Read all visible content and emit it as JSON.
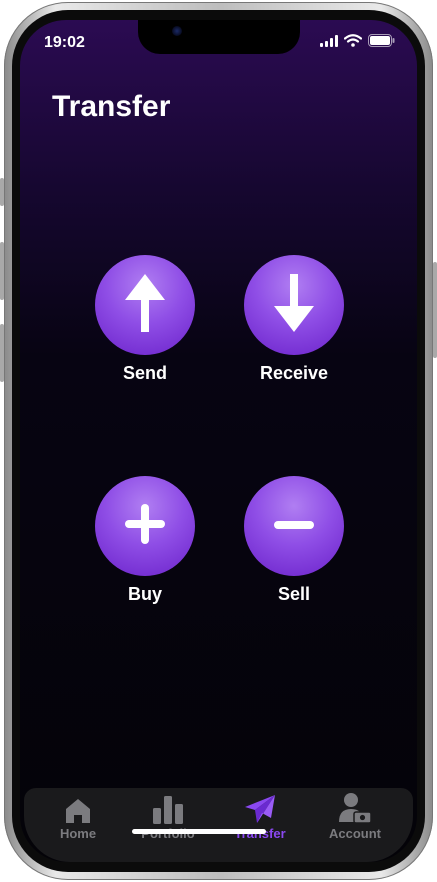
{
  "status_bar": {
    "time": "19:02"
  },
  "page": {
    "title": "Transfer"
  },
  "actions": [
    {
      "label": "Send",
      "icon": "arrow-up-icon"
    },
    {
      "label": "Receive",
      "icon": "arrow-down-icon"
    },
    {
      "label": "Buy",
      "icon": "plus-icon"
    },
    {
      "label": "Sell",
      "icon": "minus-icon"
    }
  ],
  "tabbar": {
    "items": [
      {
        "label": "Home",
        "icon": "house-icon",
        "active": false
      },
      {
        "label": "Portfolio",
        "icon": "bar-chart-icon",
        "active": false
      },
      {
        "label": "Transfer",
        "icon": "paper-plane-icon",
        "active": true
      },
      {
        "label": "Account",
        "icon": "user-cash-icon",
        "active": false
      }
    ]
  },
  "colors": {
    "accent": "#8a48f0",
    "button_gradient_light": "#b07ef2",
    "button_gradient_dark": "#6a21c9",
    "tab_inactive": "#7b7b7f",
    "background_top": "#2b0b52",
    "background_bottom": "#040308"
  }
}
